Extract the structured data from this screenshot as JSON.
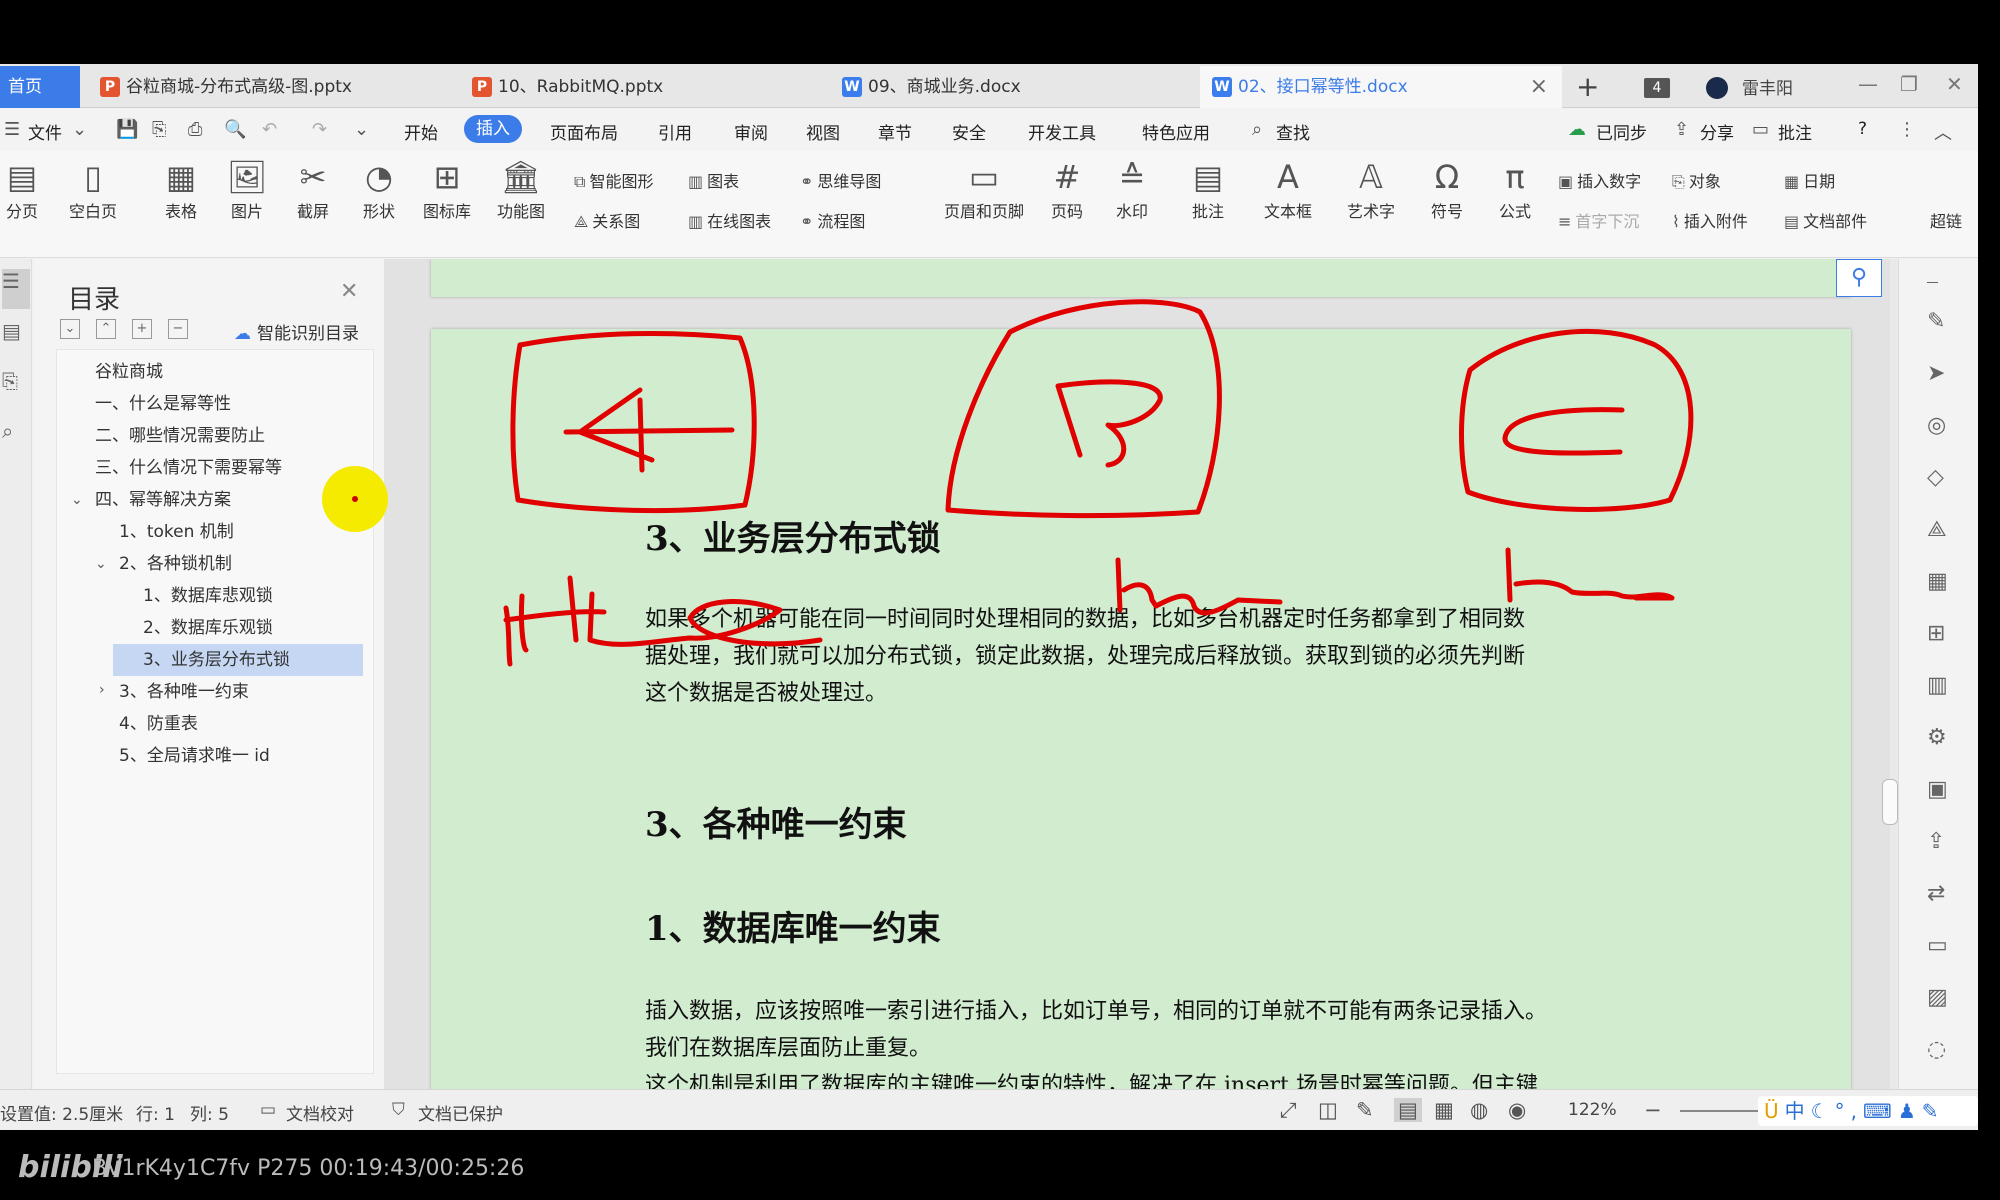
{
  "tabs": {
    "home": "首页",
    "items": [
      {
        "icon": "P",
        "label": "谷粒商城-分布式高级-图.pptx"
      },
      {
        "icon": "P",
        "label": "10、RabbitMQ.pptx"
      },
      {
        "icon": "W",
        "label": "09、商城业务.docx"
      },
      {
        "icon": "W",
        "label": "02、接口幂等性.docx"
      }
    ],
    "new_tab": "+",
    "count": "4",
    "user": "雷丰阳"
  },
  "menu": {
    "file": "文件",
    "items": [
      "开始",
      "插入",
      "页面布局",
      "引用",
      "审阅",
      "视图",
      "章节",
      "安全",
      "开发工具",
      "特色应用"
    ],
    "search": "查找",
    "sync": "已同步",
    "share": "分享",
    "comment": "批注",
    "help": "?"
  },
  "ribbon": {
    "page_break": "分页",
    "blank_page": "空白页",
    "table": "表格",
    "picture": "图片",
    "screenshot": "截屏",
    "shape": "形状",
    "icon_lib": "图标库",
    "func_chart": "功能图",
    "smart_shape": "智能图形",
    "chart": "图表",
    "mind_map": "思维导图",
    "relation": "关系图",
    "online_chart": "在线图表",
    "flowchart": "流程图",
    "header_footer": "页眉和页脚",
    "page_num": "页码",
    "watermark": "水印",
    "comment": "批注",
    "text_box": "文本框",
    "art_text": "艺术字",
    "symbol": "符号",
    "formula": "公式",
    "insert_number": "插入数字",
    "object": "对象",
    "date": "日期",
    "drop_cap": "首字下沉",
    "attachment": "插入附件",
    "doc_parts": "文档部件",
    "hyperlink": "超链"
  },
  "toc": {
    "title": "目录",
    "smart": "智能识别目录",
    "items": [
      {
        "label": "谷粒商城"
      },
      {
        "label": "一、什么是幂等性"
      },
      {
        "label": "二、哪些情况需要防止"
      },
      {
        "label": "三、什么情况下需要幂等"
      },
      {
        "label": "四、幂等解决方案"
      },
      {
        "label": "1、token 机制"
      },
      {
        "label": "2、各种锁机制"
      },
      {
        "label": "1、数据库悲观锁"
      },
      {
        "label": "2、数据库乐观锁"
      },
      {
        "label": "3、业务层分布式锁"
      },
      {
        "label": "3、各种唯一约束"
      },
      {
        "label": "4、防重表"
      },
      {
        "label": "5、全局请求唯一 id"
      }
    ]
  },
  "document": {
    "heading1": "3、业务层分布式锁",
    "para1": [
      "如果多个机器可能在同一时间同时处理相同的数据，比如多台机器定时任务都拿到了相同数",
      "据处理，我们就可以加分布式锁，锁定此数据，处理完成后释放锁。获取到锁的必须先判断",
      "这个数据是否被处理过。"
    ],
    "heading2": "3、各种唯一约束",
    "heading3": "1、数据库唯一约束",
    "para2": [
      "插入数据，应该按照唯一索引进行插入，比如订单号，相同的订单就不可能有两条记录插入。",
      "我们在数据库层面防止重复。",
      "这个机制是利用了数据库的主键唯一约束的特性，解决了在 insert 场景时幂等问题。但主键"
    ]
  },
  "status": {
    "setting": "设置值: 2.5厘米",
    "row": "行: 1",
    "col": "列: 5",
    "proofread": "文档校对",
    "protected": "文档已保护",
    "zoom": "122%",
    "ime": "中"
  },
  "overlay": {
    "logo": "bilibili",
    "video_info": "BV1rK4y1C7fv P275 00:19:43/00:25:26"
  },
  "colors": {
    "accent": "#3c7ce8",
    "page_bg": "#d2ecd0",
    "ink": "#e00000",
    "laser": "#f5eb00"
  }
}
